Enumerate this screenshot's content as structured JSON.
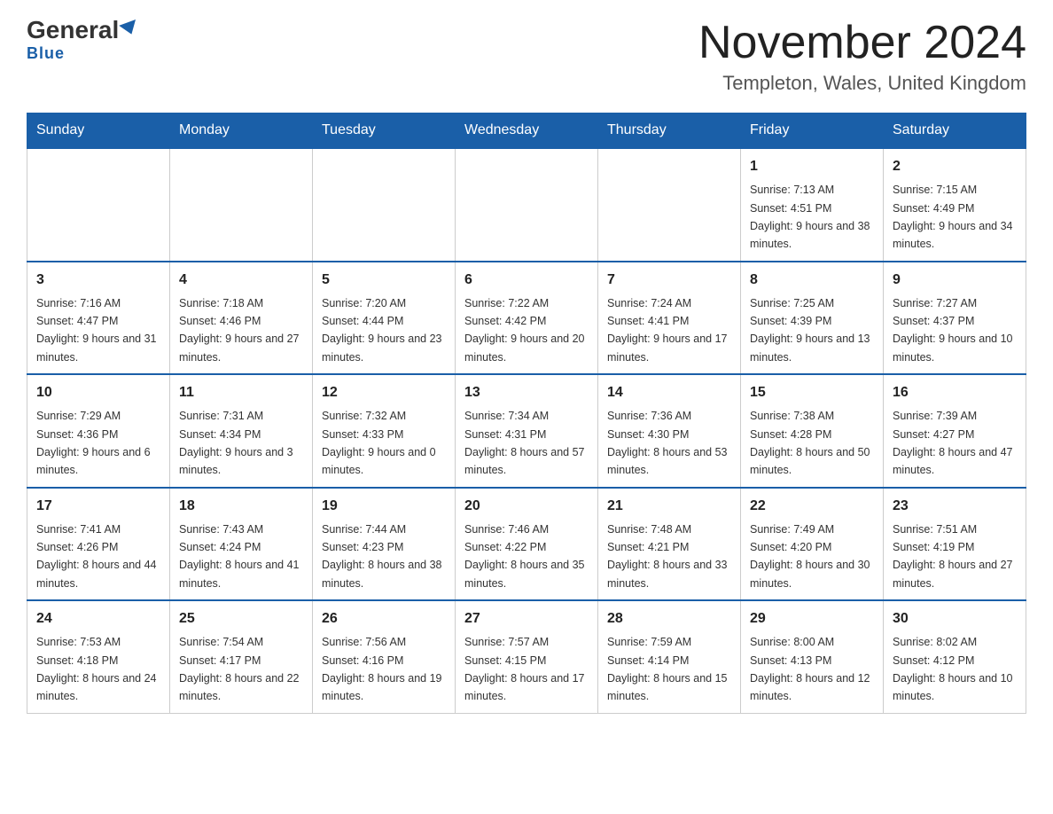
{
  "header": {
    "logo_general": "General",
    "logo_blue": "Blue",
    "title": "November 2024",
    "subtitle": "Templeton, Wales, United Kingdom"
  },
  "weekdays": [
    "Sunday",
    "Monday",
    "Tuesday",
    "Wednesday",
    "Thursday",
    "Friday",
    "Saturday"
  ],
  "weeks": [
    [
      {
        "day": "",
        "info": ""
      },
      {
        "day": "",
        "info": ""
      },
      {
        "day": "",
        "info": ""
      },
      {
        "day": "",
        "info": ""
      },
      {
        "day": "",
        "info": ""
      },
      {
        "day": "1",
        "info": "Sunrise: 7:13 AM\nSunset: 4:51 PM\nDaylight: 9 hours and 38 minutes."
      },
      {
        "day": "2",
        "info": "Sunrise: 7:15 AM\nSunset: 4:49 PM\nDaylight: 9 hours and 34 minutes."
      }
    ],
    [
      {
        "day": "3",
        "info": "Sunrise: 7:16 AM\nSunset: 4:47 PM\nDaylight: 9 hours and 31 minutes."
      },
      {
        "day": "4",
        "info": "Sunrise: 7:18 AM\nSunset: 4:46 PM\nDaylight: 9 hours and 27 minutes."
      },
      {
        "day": "5",
        "info": "Sunrise: 7:20 AM\nSunset: 4:44 PM\nDaylight: 9 hours and 23 minutes."
      },
      {
        "day": "6",
        "info": "Sunrise: 7:22 AM\nSunset: 4:42 PM\nDaylight: 9 hours and 20 minutes."
      },
      {
        "day": "7",
        "info": "Sunrise: 7:24 AM\nSunset: 4:41 PM\nDaylight: 9 hours and 17 minutes."
      },
      {
        "day": "8",
        "info": "Sunrise: 7:25 AM\nSunset: 4:39 PM\nDaylight: 9 hours and 13 minutes."
      },
      {
        "day": "9",
        "info": "Sunrise: 7:27 AM\nSunset: 4:37 PM\nDaylight: 9 hours and 10 minutes."
      }
    ],
    [
      {
        "day": "10",
        "info": "Sunrise: 7:29 AM\nSunset: 4:36 PM\nDaylight: 9 hours and 6 minutes."
      },
      {
        "day": "11",
        "info": "Sunrise: 7:31 AM\nSunset: 4:34 PM\nDaylight: 9 hours and 3 minutes."
      },
      {
        "day": "12",
        "info": "Sunrise: 7:32 AM\nSunset: 4:33 PM\nDaylight: 9 hours and 0 minutes."
      },
      {
        "day": "13",
        "info": "Sunrise: 7:34 AM\nSunset: 4:31 PM\nDaylight: 8 hours and 57 minutes."
      },
      {
        "day": "14",
        "info": "Sunrise: 7:36 AM\nSunset: 4:30 PM\nDaylight: 8 hours and 53 minutes."
      },
      {
        "day": "15",
        "info": "Sunrise: 7:38 AM\nSunset: 4:28 PM\nDaylight: 8 hours and 50 minutes."
      },
      {
        "day": "16",
        "info": "Sunrise: 7:39 AM\nSunset: 4:27 PM\nDaylight: 8 hours and 47 minutes."
      }
    ],
    [
      {
        "day": "17",
        "info": "Sunrise: 7:41 AM\nSunset: 4:26 PM\nDaylight: 8 hours and 44 minutes."
      },
      {
        "day": "18",
        "info": "Sunrise: 7:43 AM\nSunset: 4:24 PM\nDaylight: 8 hours and 41 minutes."
      },
      {
        "day": "19",
        "info": "Sunrise: 7:44 AM\nSunset: 4:23 PM\nDaylight: 8 hours and 38 minutes."
      },
      {
        "day": "20",
        "info": "Sunrise: 7:46 AM\nSunset: 4:22 PM\nDaylight: 8 hours and 35 minutes."
      },
      {
        "day": "21",
        "info": "Sunrise: 7:48 AM\nSunset: 4:21 PM\nDaylight: 8 hours and 33 minutes."
      },
      {
        "day": "22",
        "info": "Sunrise: 7:49 AM\nSunset: 4:20 PM\nDaylight: 8 hours and 30 minutes."
      },
      {
        "day": "23",
        "info": "Sunrise: 7:51 AM\nSunset: 4:19 PM\nDaylight: 8 hours and 27 minutes."
      }
    ],
    [
      {
        "day": "24",
        "info": "Sunrise: 7:53 AM\nSunset: 4:18 PM\nDaylight: 8 hours and 24 minutes."
      },
      {
        "day": "25",
        "info": "Sunrise: 7:54 AM\nSunset: 4:17 PM\nDaylight: 8 hours and 22 minutes."
      },
      {
        "day": "26",
        "info": "Sunrise: 7:56 AM\nSunset: 4:16 PM\nDaylight: 8 hours and 19 minutes."
      },
      {
        "day": "27",
        "info": "Sunrise: 7:57 AM\nSunset: 4:15 PM\nDaylight: 8 hours and 17 minutes."
      },
      {
        "day": "28",
        "info": "Sunrise: 7:59 AM\nSunset: 4:14 PM\nDaylight: 8 hours and 15 minutes."
      },
      {
        "day": "29",
        "info": "Sunrise: 8:00 AM\nSunset: 4:13 PM\nDaylight: 8 hours and 12 minutes."
      },
      {
        "day": "30",
        "info": "Sunrise: 8:02 AM\nSunset: 4:12 PM\nDaylight: 8 hours and 10 minutes."
      }
    ]
  ]
}
